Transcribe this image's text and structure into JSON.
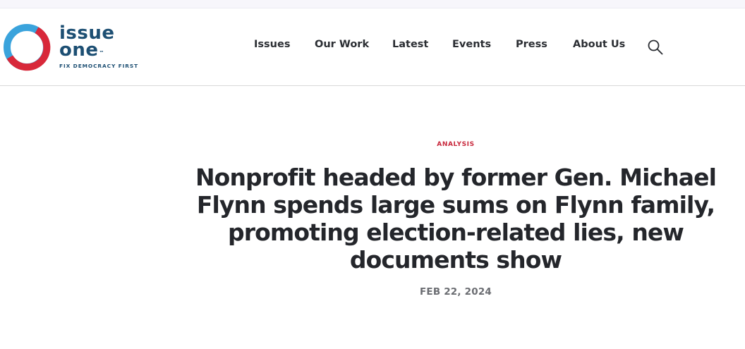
{
  "brand": {
    "word_line1": "issue",
    "word_line2": "one",
    "trademark": "™",
    "tagline": "FIX DEMOCRACY FIRST",
    "colors": {
      "navy": "#1d4f73",
      "red": "#d8283a",
      "blue": "#3aa3dc"
    }
  },
  "nav": {
    "items": [
      {
        "label": "Issues"
      },
      {
        "label": "Our Work"
      },
      {
        "label": "Latest"
      },
      {
        "label": "Events"
      },
      {
        "label": "Press"
      },
      {
        "label": "About Us"
      }
    ],
    "search_icon": "search-icon"
  },
  "article": {
    "kicker": "ANALYSIS",
    "title": "Nonprofit headed by former Gen. Michael Flynn spends large sums on Flynn family, promoting election-related lies, new documents show",
    "date": "FEB 22, 2024"
  },
  "colors": {
    "accent": "#c8283c",
    "text": "#24262b",
    "muted": "#6b6d72",
    "divider": "#d7d7d7"
  }
}
